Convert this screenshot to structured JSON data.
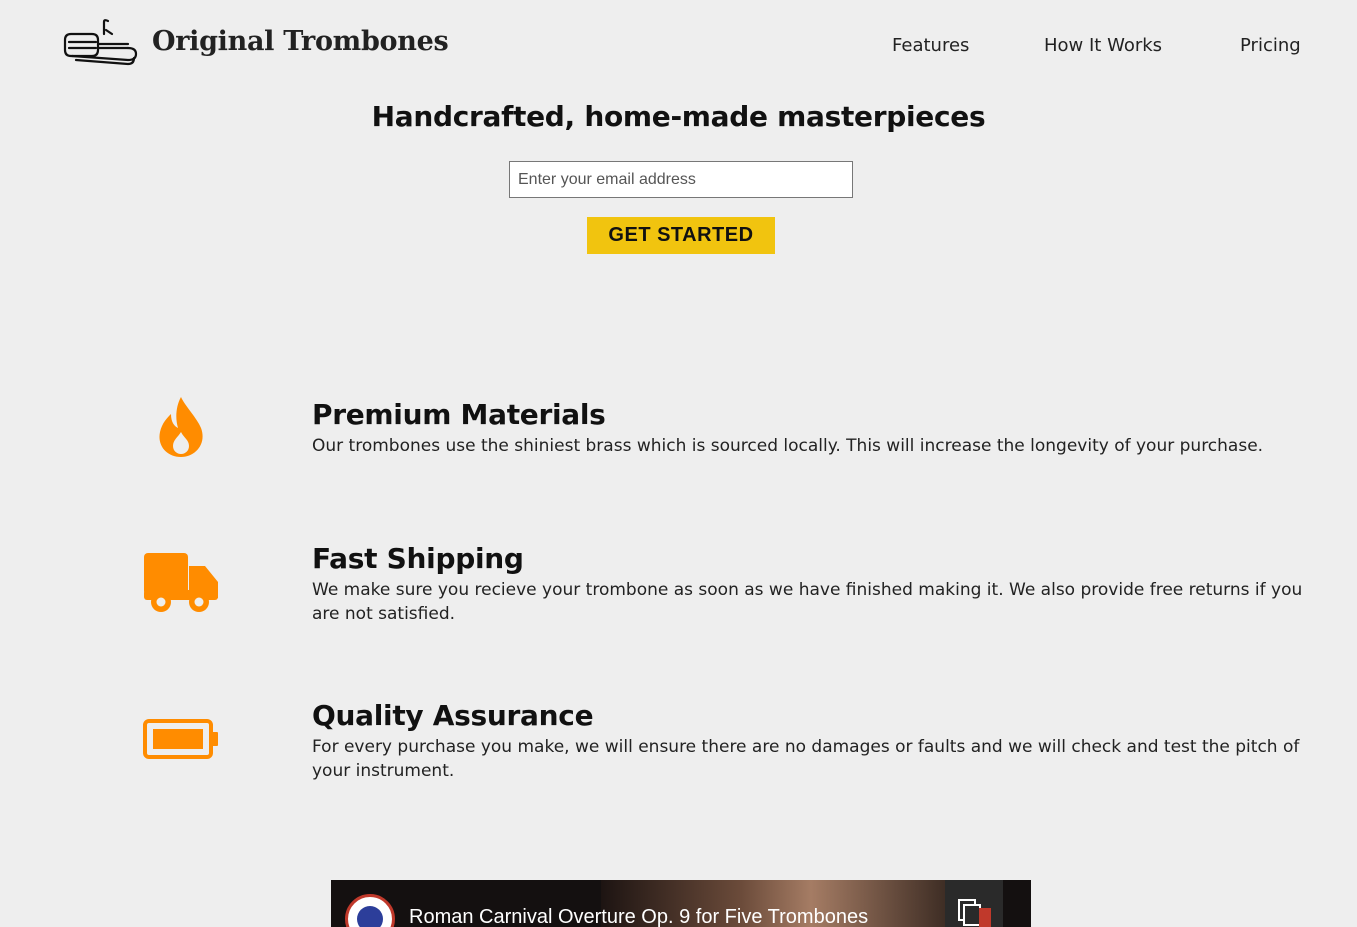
{
  "header": {
    "brand": "Original Trombones",
    "nav": [
      "Features",
      "How It Works",
      "Pricing"
    ]
  },
  "hero": {
    "title": "Handcrafted, home-made masterpieces",
    "email_placeholder": "Enter your email address",
    "cta_label": "GET STARTED"
  },
  "features": [
    {
      "icon": "fire-icon",
      "title": "Premium Materials",
      "text": "Our trombones use the shiniest brass which is sourced locally. This will increase the longevity of your purchase."
    },
    {
      "icon": "truck-icon",
      "title": "Fast Shipping",
      "text": "We make sure you recieve your trombone as soon as we have finished making it. We also provide free returns if you are not satisfied."
    },
    {
      "icon": "battery-icon",
      "title": "Quality Assurance",
      "text": "For every purchase you make, we will ensure there are no damages or faults and we will check and test the pitch of your instrument."
    }
  ],
  "video": {
    "title": "Roman Carnival Overture Op. 9 for Five Trombones"
  },
  "colors": {
    "background": "#eeeeee",
    "accent_icon": "#ff8c00",
    "cta": "#f1c40f"
  }
}
